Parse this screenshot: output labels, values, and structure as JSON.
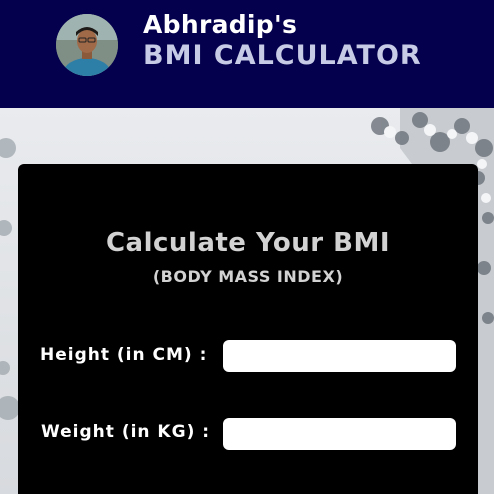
{
  "header": {
    "title_line1": "Abhradip's",
    "title_line2": "BMI CALCULATOR",
    "avatar_icon": "profile-photo"
  },
  "form": {
    "title": "Calculate Your BMI",
    "subtitle": "(BODY MASS INDEX)",
    "height_label": "Height (in CM) :",
    "height_value": "",
    "weight_label": "Weight (in KG) :",
    "weight_value": ""
  },
  "colors": {
    "header_bg": "#04004d",
    "card_bg": "#000000",
    "title_line2": "#c7cbe6"
  }
}
